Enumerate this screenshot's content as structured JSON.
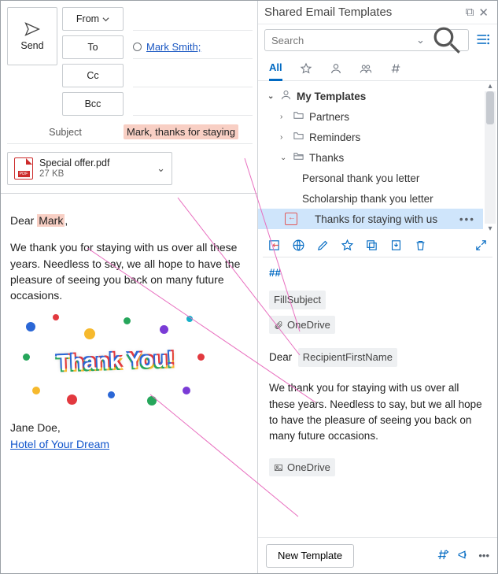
{
  "compose": {
    "send_label": "Send",
    "from_label": "From",
    "to_label": "To",
    "cc_label": "Cc",
    "bcc_label": "Bcc",
    "recipient": "Mark Smith;",
    "subject_label": "Subject",
    "subject_value": "Mark, thanks for staying",
    "attachment": {
      "name": "Special offer.pdf",
      "size": "27 KB"
    },
    "body": {
      "greeting_prefix": "Dear ",
      "greeting_name": "Mark",
      "greeting_suffix": ",",
      "paragraph": "We thank you for staying with us over all these years. Needless to say, we all hope to have the pleasure of seeing you back on many future occasions.",
      "image_text": "Thank You!",
      "signoff_name": "Jane Doe,",
      "signoff_link": "Hotel of Your Dream"
    }
  },
  "pane": {
    "title": "Shared Email Templates",
    "search_placeholder": "Search",
    "tabs": {
      "all": "All"
    },
    "tree": {
      "root": "My Templates",
      "folders": [
        "Partners",
        "Reminders",
        "Thanks"
      ],
      "thanks_items": [
        "Personal thank you letter",
        "Scholarship thank you letter",
        "Thanks for staying with us"
      ]
    },
    "preview": {
      "macro_mark": "##",
      "fill_subject": "FillSubject",
      "onedrive": "OneDrive",
      "dear": "Dear",
      "recipient_token": "RecipientFirstName",
      "paragraph": "We thank you for staying with us over all these years. Needless  to say, but we all hope to have the pleasure of seeing you back on many future occasions.",
      "onedrive2": "OneDrive"
    },
    "footer": {
      "new_template": "New Template"
    }
  }
}
